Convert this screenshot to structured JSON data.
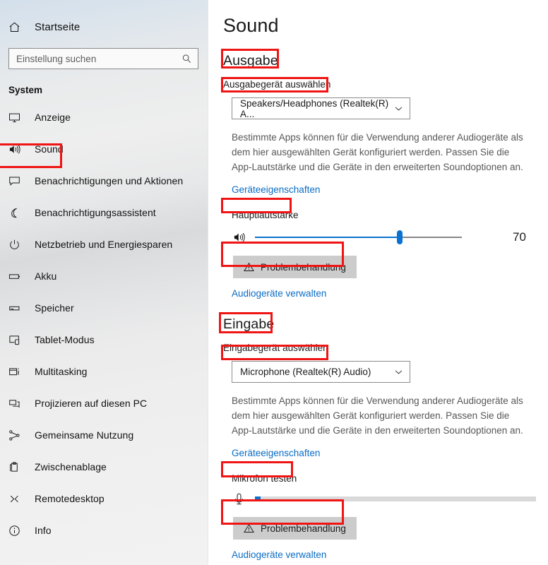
{
  "sidebar": {
    "home": {
      "label": "Startseite",
      "icon": "home-icon"
    },
    "search": {
      "placeholder": "Einstellung suchen",
      "value": "",
      "icon": "search-icon"
    },
    "group_title": "System",
    "items": [
      {
        "label": "Anzeige",
        "icon": "monitor-icon",
        "selected": false
      },
      {
        "label": "Sound",
        "icon": "speaker-icon",
        "selected": true
      },
      {
        "label": "Benachrichtigungen und Aktionen",
        "icon": "chat-bubble-icon",
        "selected": false
      },
      {
        "label": "Benachrichtigungsassistent",
        "icon": "moon-icon",
        "selected": false
      },
      {
        "label": "Netzbetrieb und Energiesparen",
        "icon": "power-icon",
        "selected": false
      },
      {
        "label": "Akku",
        "icon": "battery-icon",
        "selected": false
      },
      {
        "label": "Speicher",
        "icon": "storage-icon",
        "selected": false
      },
      {
        "label": "Tablet-Modus",
        "icon": "tablet-icon",
        "selected": false
      },
      {
        "label": "Multitasking",
        "icon": "multitasking-icon",
        "selected": false
      },
      {
        "label": "Projizieren auf diesen PC",
        "icon": "project-screen-icon",
        "selected": false
      },
      {
        "label": "Gemeinsame Nutzung",
        "icon": "share-icon",
        "selected": false
      },
      {
        "label": "Zwischenablage",
        "icon": "clipboard-icon",
        "selected": false
      },
      {
        "label": "Remotedesktop",
        "icon": "remote-desktop-icon",
        "selected": false
      },
      {
        "label": "Info",
        "icon": "info-icon",
        "selected": false
      }
    ]
  },
  "main": {
    "page_title": "Sound",
    "output": {
      "heading": "Ausgabe",
      "device_label": "Ausgabegerät auswählen",
      "device_value": "Speakers/Headphones (Realtek(R) A...",
      "description": "Bestimmte Apps können für die Verwendung anderer Audiogeräte als dem hier ausgewählten Gerät konfiguriert werden. Passen Sie die App-Lautstärke und die Geräte in den erweiterten Soundoptionen an.",
      "properties_link": "Geräteeigenschaften",
      "volume_label": "Hauptlautstärke",
      "volume_value": "70",
      "volume_percent": 70,
      "troubleshoot_button": "Problembehandlung",
      "manage_link": "Audiogeräte verwalten"
    },
    "input": {
      "heading": "Eingabe",
      "device_label": "Eingabegerät auswählen",
      "device_value": "Microphone (Realtek(R) Audio)",
      "description": "Bestimmte Apps können für die Verwendung anderer Audiogeräte als dem hier ausgewählten Gerät konfiguriert werden. Passen Sie die App-Lautstärke und die Geräte in den erweiterten Soundoptionen an.",
      "properties_link": "Geräteeigenschaften",
      "test_label": "Mikrofon testen",
      "test_level_percent": 2,
      "troubleshoot_button": "Problembehandlung",
      "manage_link": "Audiogeräte verwalten"
    }
  },
  "annotations": {
    "highlight_color": "#f01414",
    "boxes": [
      "sidebar-sound-item",
      "output-heading",
      "output-device-label",
      "volume-label",
      "output-troubleshoot",
      "input-heading",
      "input-device-label",
      "mic-test-label",
      "input-troubleshoot"
    ]
  },
  "colors": {
    "accent_blue": "#0a72d0",
    "link_blue": "#0a6cc4",
    "button_gray": "#cccccc"
  }
}
